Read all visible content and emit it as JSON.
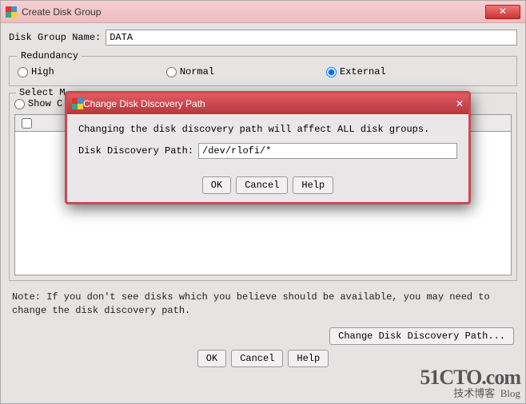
{
  "main": {
    "title": "Create Disk Group",
    "name_label": "Disk Group Name:",
    "name_value": "DATA",
    "redundancy": {
      "legend": "Redundancy",
      "options": [
        "High",
        "Normal",
        "External"
      ],
      "selected": "External"
    },
    "member": {
      "legend_partial": "Select M",
      "show_label_partial": "Show C"
    },
    "note": "Note: If you don't see disks which you believe should be available, you may need to change the disk discovery path.",
    "change_path_btn": "Change Disk Discovery Path...",
    "buttons": {
      "ok": "OK",
      "cancel": "Cancel",
      "help": "Help"
    }
  },
  "modal": {
    "title": "Change Disk Discovery Path",
    "warning": "Changing the disk discovery path will affect ALL disk groups.",
    "path_label": "Disk Discovery Path:",
    "path_value": "/dev/rlofi/*",
    "buttons": {
      "ok": "OK",
      "cancel": "Cancel",
      "help": "Help"
    }
  },
  "watermark": {
    "line1": "51CTO.com",
    "line2": "技术博客",
    "tag": "Blog"
  }
}
